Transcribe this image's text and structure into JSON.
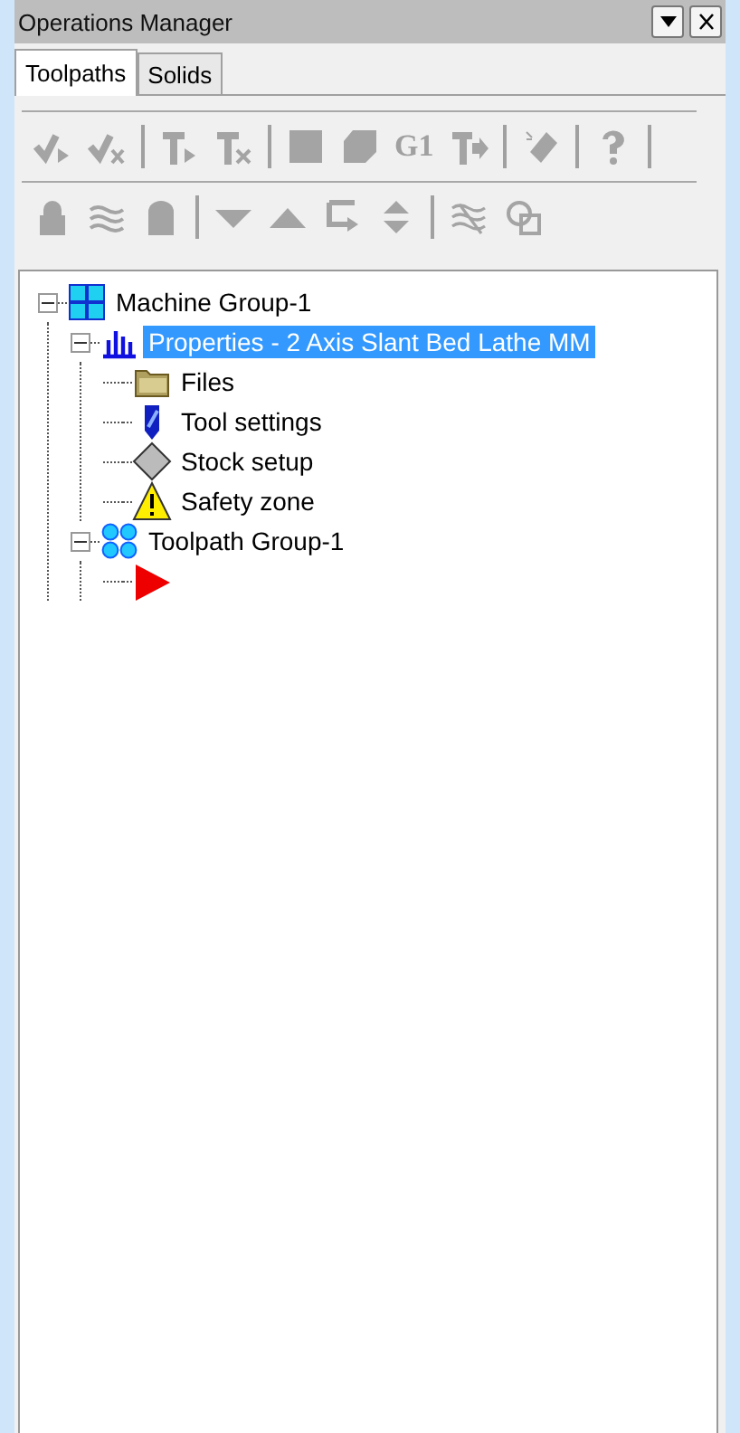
{
  "panel": {
    "title": "Operations Manager"
  },
  "tabs": [
    {
      "label": "Toolpaths",
      "selected": true
    },
    {
      "label": "Solids",
      "selected": false
    }
  ],
  "toolbar": {
    "g_code_label": "G1"
  },
  "tree": [
    {
      "kind": "machine",
      "label": "Machine Group-1",
      "expanded": true,
      "selected": false,
      "children": [
        {
          "kind": "properties",
          "label": "Properties - 2 Axis Slant Bed Lathe MM",
          "expanded": true,
          "selected": true,
          "children": [
            {
              "kind": "folder",
              "label": "Files",
              "selected": false
            },
            {
              "kind": "tool",
              "label": "Tool settings",
              "selected": false
            },
            {
              "kind": "stock",
              "label": "Stock setup",
              "selected": false
            },
            {
              "kind": "safety",
              "label": "Safety zone",
              "selected": false
            }
          ]
        },
        {
          "kind": "group",
          "label": "Toolpath Group-1",
          "expanded": true,
          "selected": false,
          "children": [
            {
              "kind": "flag"
            }
          ]
        }
      ]
    }
  ]
}
